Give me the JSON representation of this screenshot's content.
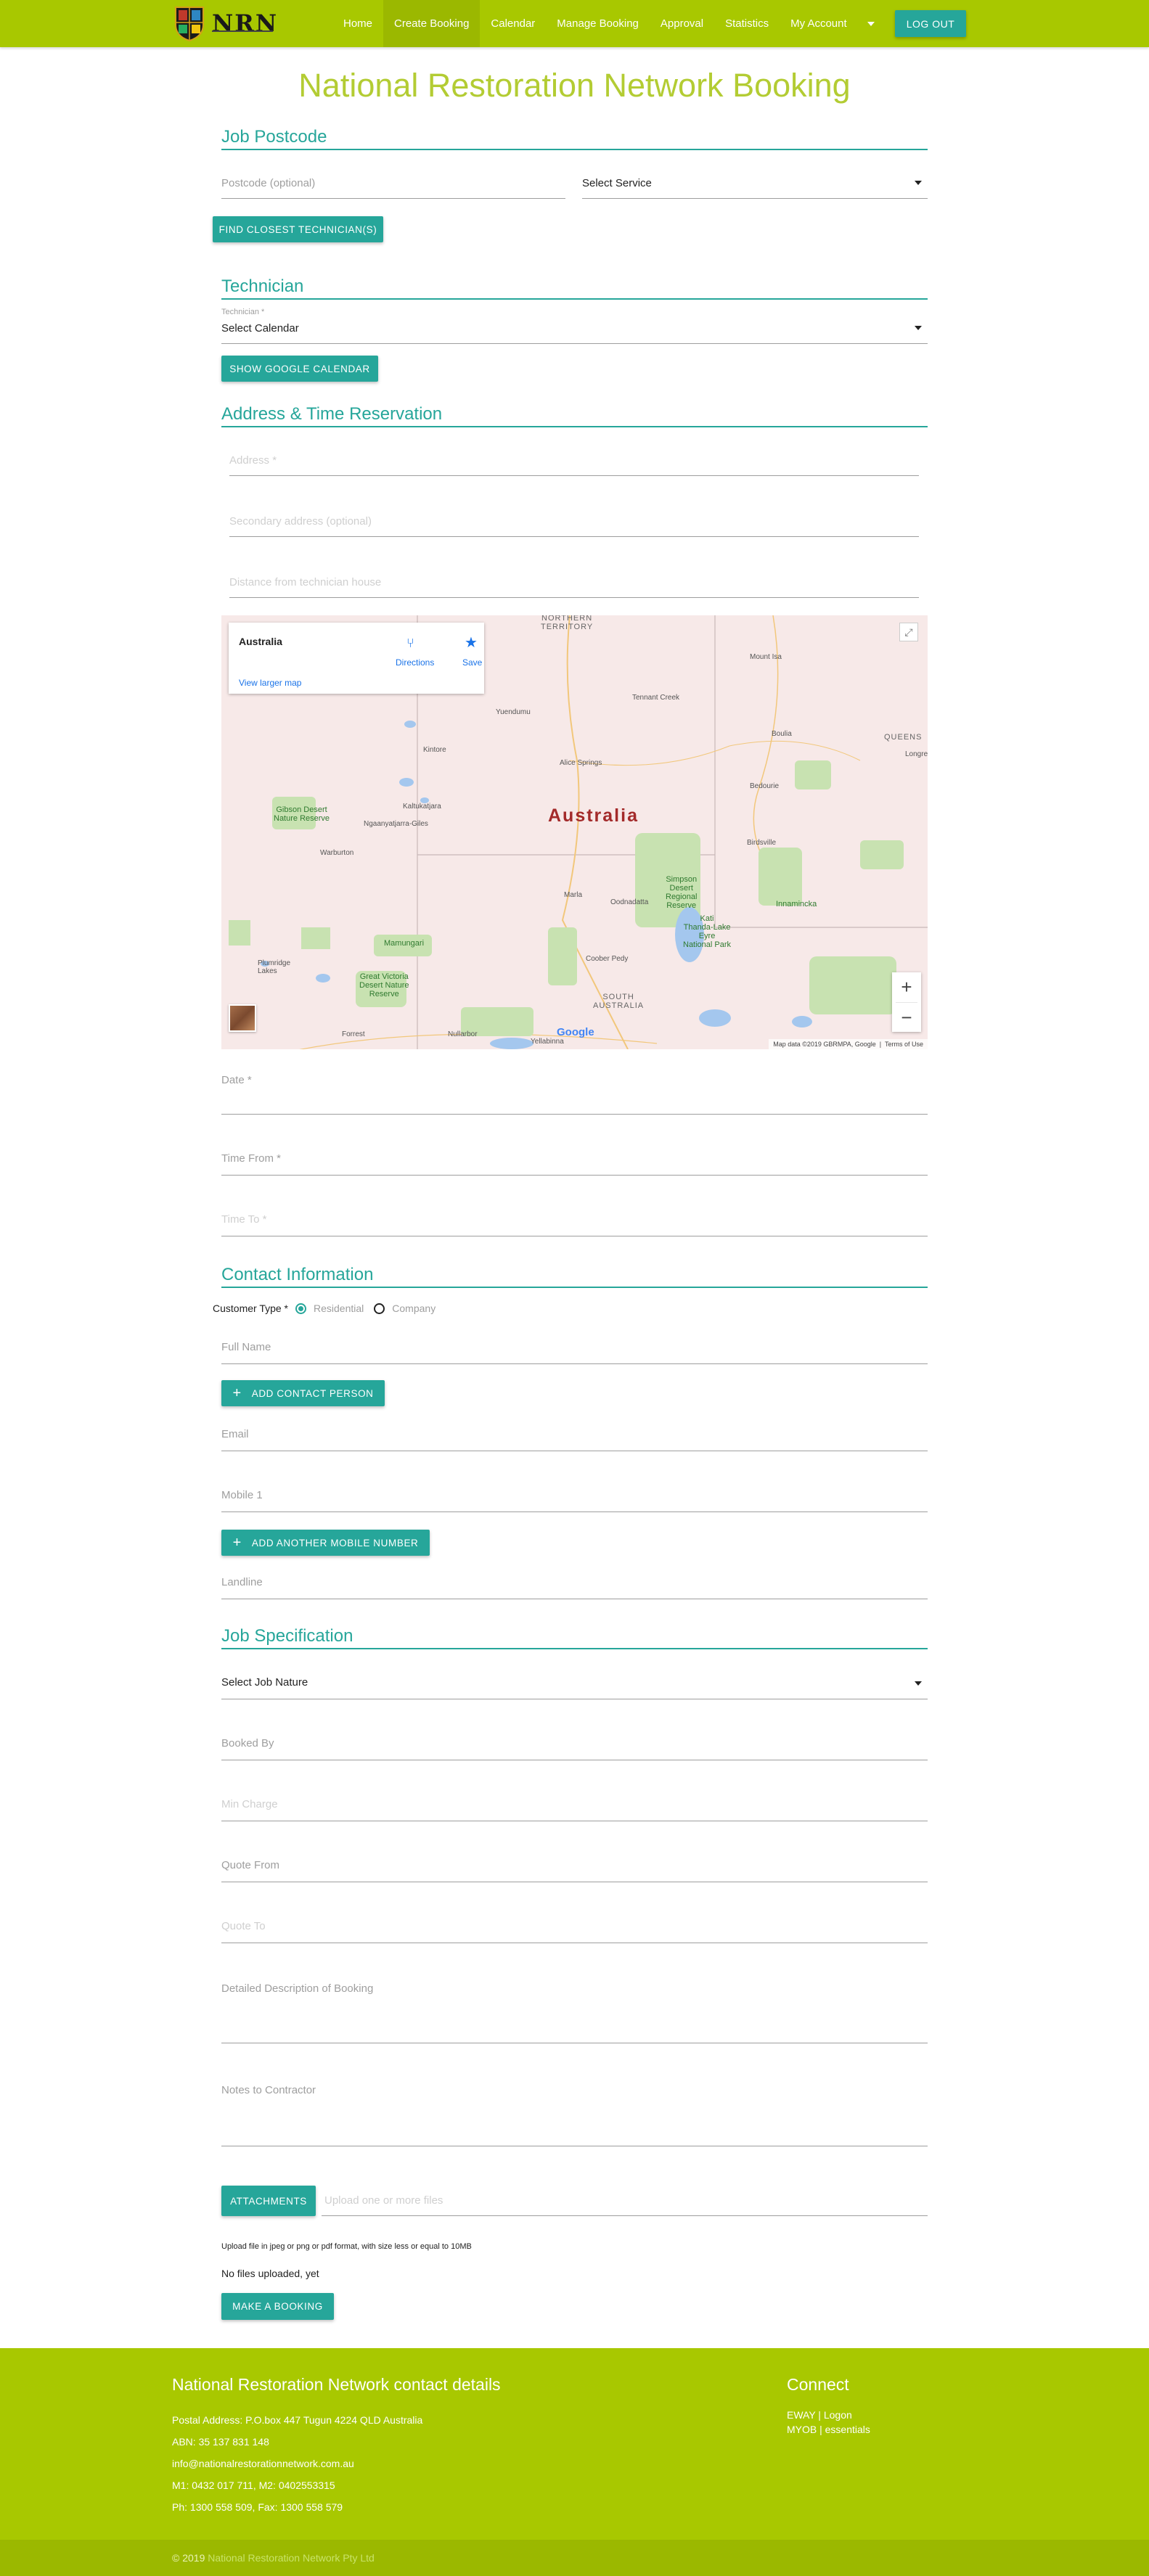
{
  "nav": {
    "logo_text": "NRN",
    "items": [
      {
        "label": "Home",
        "active": false
      },
      {
        "label": "Create Booking",
        "active": true
      },
      {
        "label": "Calendar",
        "active": false
      },
      {
        "label": "Manage Booking",
        "active": false
      },
      {
        "label": "Approval",
        "active": false
      },
      {
        "label": "Statistics",
        "active": false
      },
      {
        "label": "My Account",
        "active": false
      }
    ],
    "logout_label": "LOG OUT"
  },
  "page_title": "National Restoration Network Booking",
  "postcode_section": {
    "title": "Job Postcode",
    "postcode_placeholder": "Postcode (optional)",
    "service_value": "Select Service",
    "find_button": "FIND CLOSEST TECHNICIAN(S)"
  },
  "technician_section": {
    "title": "Technician",
    "label": "Technician *",
    "calendar_value": "Select Calendar",
    "google_button": "SHOW GOOGLE CALENDAR"
  },
  "address_section": {
    "title": "Address & Time Reservation",
    "address_placeholder": "Address *",
    "secondary_placeholder": "Secondary address (optional)",
    "distance_placeholder": "Distance from technician house"
  },
  "map": {
    "place_name": "Australia",
    "directions_label": "Directions",
    "save_label": "Save",
    "larger_map_label": "View larger map",
    "country_label": "Australia",
    "attribution": "Map data ©2019 GBRMPA, Google",
    "terms": "Terms of Use",
    "google_logo": "Google",
    "labels": {
      "nt": "NORTHERN\nTERRITORY",
      "sa": "SOUTH\nAUSTRALIA",
      "qld": "QUEENS",
      "mount_isa": "Mount Isa",
      "tennant_creek": "Tennant Creek",
      "yuendumu": "Yuendumu",
      "alice_springs": "Alice Springs",
      "kintore": "Kintore",
      "boulia": "Boulia",
      "bedourie": "Bedourie",
      "birdsville": "Birdsville",
      "gibson": "Gibson Desert\nNature Reserve",
      "kaltukatjara": "Kaltukatjara",
      "ngaanyatjarra": "Ngaanyatjarra-Giles",
      "warburton": "Warburton",
      "simpson": "Simpson\nDesert\nRegional\nReserve",
      "innamincka": "Innamincka",
      "kati": "Kati\nThanda-Lake\nEyre\nNational Park",
      "marla": "Marla",
      "oodnadatta": "Oodnadatta",
      "mamungari": "Mamungari",
      "coober_pedy": "Coober Pedy",
      "great_victoria": "Great Victoria\nDesert Nature\nReserve",
      "plumridge": "Plumridge\nLakes",
      "nullarbor": "Nullarbor",
      "yellabinna": "Yellabinna",
      "forrest": "Forrest",
      "longreach": "Longre"
    }
  },
  "time_fields": {
    "date_placeholder": "Date *",
    "time_from_placeholder": "Time From *",
    "time_to_placeholder": "Time To *"
  },
  "contact_section": {
    "title": "Contact Information",
    "customer_type_label": "Customer Type *",
    "residential_label": "Residential",
    "company_label": "Company",
    "full_name_placeholder": "Full Name",
    "add_contact_button": "ADD CONTACT PERSON",
    "email_placeholder": "Email",
    "mobile_placeholder": "Mobile 1",
    "add_mobile_button": "ADD ANOTHER MOBILE NUMBER",
    "landline_placeholder": "Landline"
  },
  "job_section": {
    "title": "Job Specification",
    "job_nature_value": "Select Job Nature",
    "booked_by_placeholder": "Booked By",
    "min_charge_placeholder": "Min Charge",
    "quote_from_placeholder": "Quote From",
    "quote_to_placeholder": "Quote To",
    "description_placeholder": "Detailed Description of Booking",
    "notes_placeholder": "Notes to Contractor",
    "attachments_button": "ATTACHMENTS",
    "upload_placeholder": "Upload one or more files",
    "upload_note": "Upload file in  jpeg or png or pdf  format, with size less or equal to 10MB",
    "files_status": "No files uploaded, yet",
    "booking_button": "MAKE A BOOKING"
  },
  "footer": {
    "title": "National Restoration Network contact details",
    "postal": "Postal Address: P.O.box 447 Tugun 4224 QLD Australia",
    "abn": "ABN: 35 137 831 148",
    "email": "info@nationalrestorationnetwork.com.au",
    "mobiles": "M1: 0432 017 711, M2: 0402553315",
    "phones": "Ph: 1300 558 509, Fax: 1300 558 579",
    "connect_title": "Connect",
    "eway": "EWAY | Logon",
    "myob": "MYOB | essentials",
    "copyright_prefix": "© 2019",
    "copyright_brand": "National Restoration Network Pty Ltd"
  },
  "colors": {
    "nav_green": "#a8c800",
    "teal": "#26a69a",
    "title_green": "#b3cc33"
  }
}
